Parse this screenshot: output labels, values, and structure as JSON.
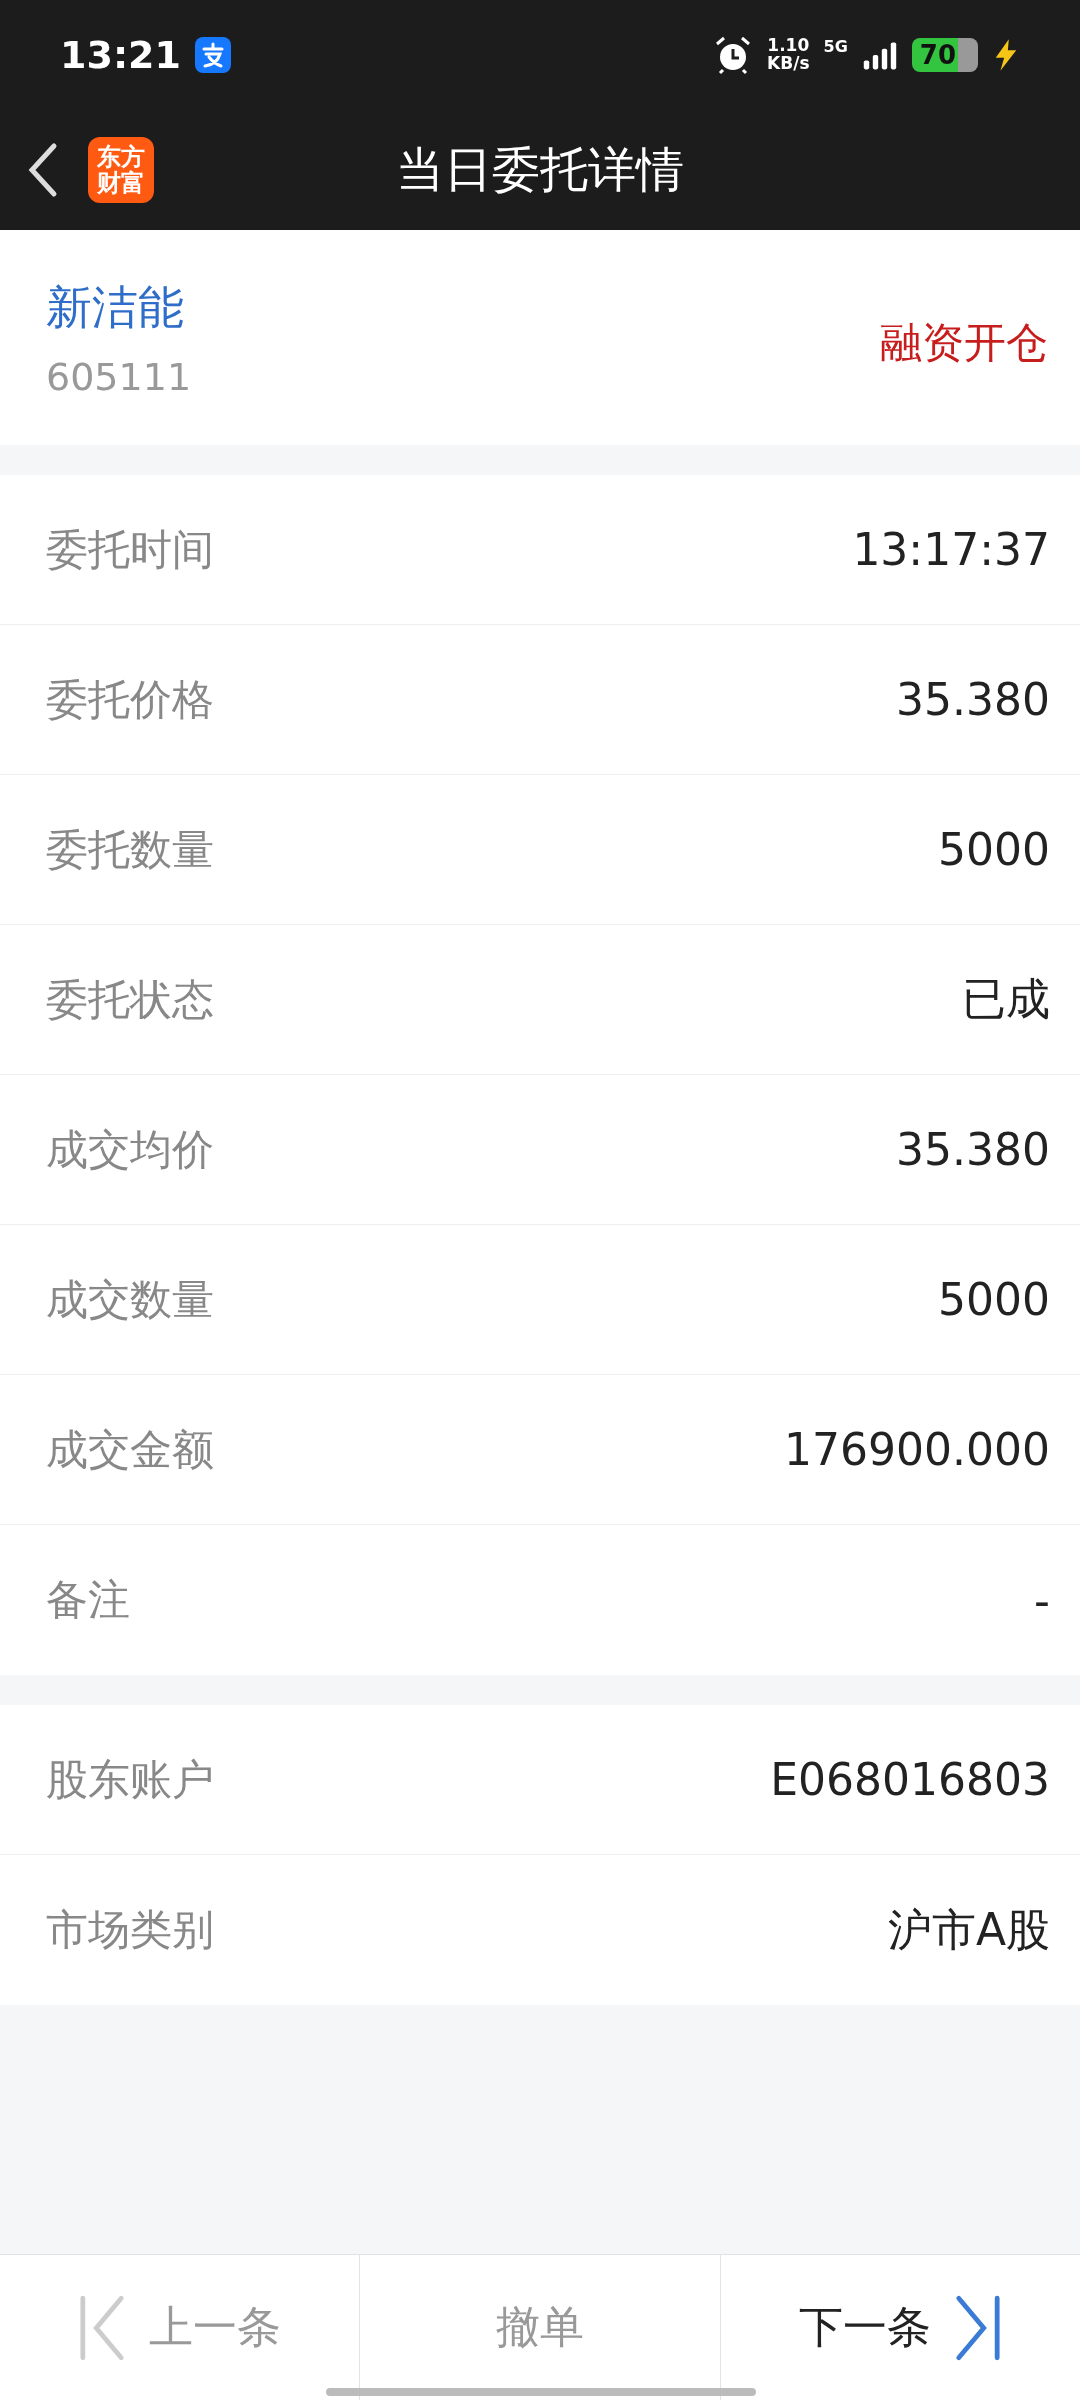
{
  "status_bar": {
    "time": "13:21",
    "net_speed": "1.10",
    "net_unit": "KB/s",
    "network": "5G",
    "battery": "70"
  },
  "header": {
    "logo_lines": [
      "东方",
      "财富"
    ],
    "title": "当日委托详情"
  },
  "stock": {
    "name": "新洁能",
    "code": "605111",
    "order_type": "融资开仓"
  },
  "details": [
    {
      "label": "委托时间",
      "value": "13:17:37"
    },
    {
      "label": "委托价格",
      "value": "35.380"
    },
    {
      "label": "委托数量",
      "value": "5000"
    },
    {
      "label": "委托状态",
      "value": "已成"
    },
    {
      "label": "成交均价",
      "value": "35.380"
    },
    {
      "label": "成交数量",
      "value": "5000"
    },
    {
      "label": "成交金额",
      "value": "176900.000"
    },
    {
      "label": "备注",
      "value": "-"
    }
  ],
  "account": [
    {
      "label": "股东账户",
      "value": "E068016803"
    },
    {
      "label": "市场类别",
      "value": "沪市A股"
    }
  ],
  "bottom_bar": [
    {
      "kind": "prev",
      "label": "上一条",
      "disabled": true
    },
    {
      "kind": "cancel",
      "label": "撤单",
      "disabled": true
    },
    {
      "kind": "next",
      "label": "下一条",
      "disabled": false
    }
  ]
}
